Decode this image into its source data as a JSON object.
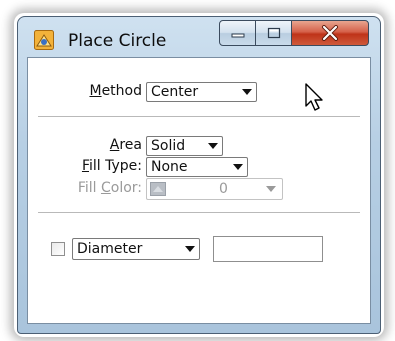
{
  "window": {
    "title": "Place Circle",
    "icon": "place-circle-app-icon",
    "buttons": {
      "minimize": "minimize-icon",
      "maximize": "maximize-icon",
      "close": "close-icon"
    }
  },
  "method": {
    "label_u": "M",
    "label_rest": "ethod",
    "value": "Center"
  },
  "area": {
    "label_u": "A",
    "label_rest": "rea",
    "value": "Solid"
  },
  "fill_type": {
    "label_u": "F",
    "label_rest": "ill Type:",
    "value": "None"
  },
  "fill_color": {
    "label_pre": "Fill ",
    "label_u": "C",
    "label_rest": "olor:",
    "value": "0",
    "enabled": false
  },
  "diameter": {
    "checked": false,
    "mode": "Diameter",
    "value": ""
  },
  "colors": {
    "close_red": "#c8391d",
    "chrome_blue": "#b7cfe4",
    "disabled_gray": "#9a9a9a"
  }
}
